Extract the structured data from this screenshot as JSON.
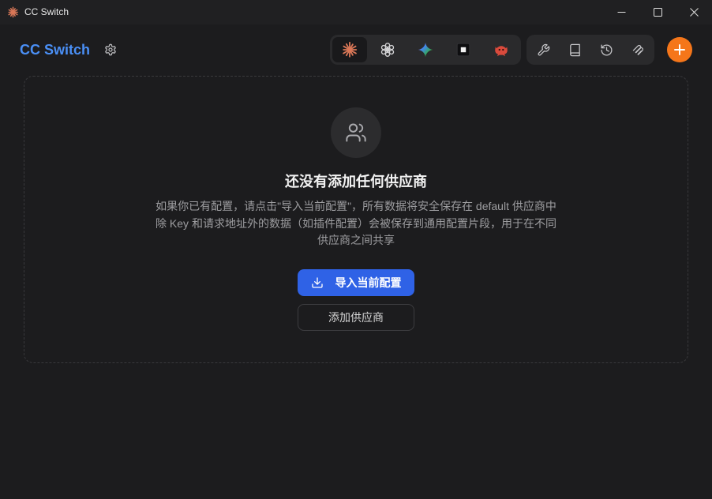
{
  "window": {
    "title": "CC Switch",
    "app_icon": "claude-starburst-icon",
    "controls": [
      "minimize-icon",
      "maximize-icon",
      "close-icon"
    ]
  },
  "header": {
    "app_name": "CC Switch",
    "settings_icon": "gear-icon"
  },
  "app_switcher": {
    "items": [
      {
        "icon": "claude-icon",
        "selected": true
      },
      {
        "icon": "openai-icon",
        "selected": false
      },
      {
        "icon": "gemini-icon",
        "selected": false
      },
      {
        "icon": "terminal-square-icon",
        "selected": false
      },
      {
        "icon": "crab-icon",
        "selected": false
      }
    ]
  },
  "tools": {
    "items": [
      {
        "icon": "wrench-icon"
      },
      {
        "icon": "book-icon"
      },
      {
        "icon": "history-icon"
      },
      {
        "icon": "mcp-icon"
      }
    ]
  },
  "add_button": {
    "icon": "plus-icon"
  },
  "empty_state": {
    "icon": "users-icon",
    "title": "还没有添加任何供应商",
    "description_lines": [
      "如果你已有配置，请点击\"导入当前配置\"，所有数据将安全保存在 default 供应商中",
      "除 Key 和请求地址外的数据（如插件配置）会被保存到通用配置片段，用于在不同",
      "供应商之间共享"
    ],
    "import_button": {
      "label": "导入当前配置",
      "icon": "download-icon"
    },
    "add_provider_button": {
      "label": "添加供应商"
    }
  },
  "colors": {
    "background": "#1c1c1e",
    "brand": "#4a8ff5",
    "primary_button": "#2f62e6",
    "add_button": "#f5761a",
    "claude": "#d97757"
  }
}
